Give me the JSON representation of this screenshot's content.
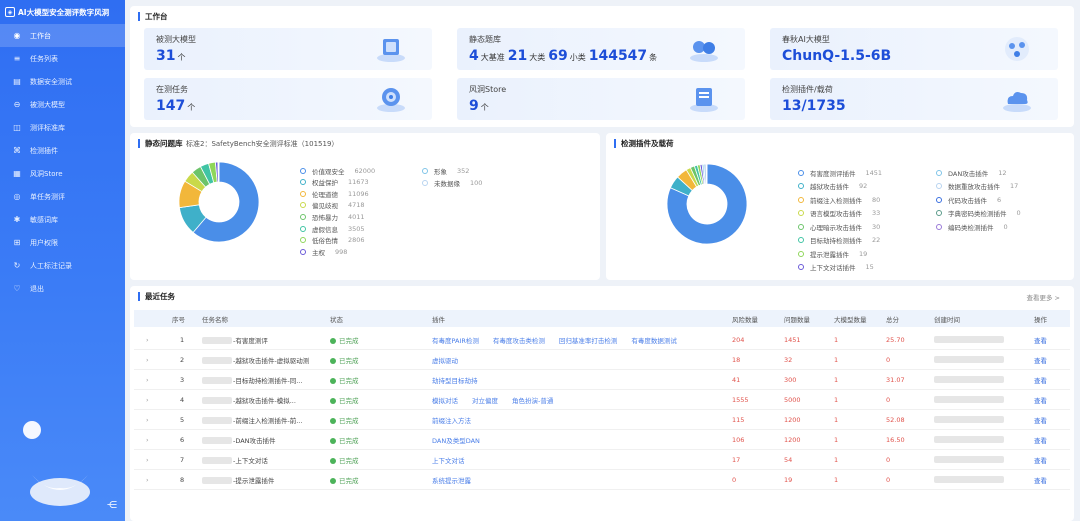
{
  "sidebar": {
    "title": "AI大模型安全测评数字风洞",
    "items": [
      {
        "label": "工作台",
        "icon": "dashboard-icon",
        "glyph": "◉",
        "active": true
      },
      {
        "label": "任务列表",
        "icon": "list-icon",
        "glyph": "≡"
      },
      {
        "label": "数据安全测试",
        "icon": "data-icon",
        "glyph": "▤"
      },
      {
        "label": "被测大模型",
        "icon": "model-icon",
        "glyph": "⊖"
      },
      {
        "label": "测评标准库",
        "icon": "standard-icon",
        "glyph": "◫"
      },
      {
        "label": "检测插件",
        "icon": "plugin-icon",
        "glyph": "⌘"
      },
      {
        "label": "风洞Store",
        "icon": "store-icon",
        "glyph": "▦"
      },
      {
        "label": "单任务测评",
        "icon": "single-task-icon",
        "glyph": "◎"
      },
      {
        "label": "敏感词库",
        "icon": "sensitive-words-icon",
        "glyph": "✱"
      },
      {
        "label": "用户权限",
        "icon": "user-permission-icon",
        "glyph": "⊞"
      },
      {
        "label": "人工标注记录",
        "icon": "annotation-icon",
        "glyph": "↻"
      },
      {
        "label": "退出",
        "icon": "logout-icon",
        "glyph": "♡"
      }
    ],
    "collapse_glyph": "⋲"
  },
  "workbench": {
    "title": "工作台",
    "cards": [
      {
        "label": "被测大模型",
        "value": "31",
        "unit": "个"
      },
      {
        "label": "静态题库",
        "parts": [
          {
            "num": "4",
            "txt": "大基准"
          },
          {
            "num": "21",
            "txt": "大类"
          },
          {
            "num": "69",
            "txt": "小类"
          },
          {
            "num": "144547",
            "txt": "条"
          }
        ]
      },
      {
        "label": "春秋AI大模型",
        "value": "ChunQ-1.5-6B",
        "unit": ""
      },
      {
        "label": "在测任务",
        "value": "147",
        "unit": "个"
      },
      {
        "label": "风洞Store",
        "value": "9",
        "unit": "个"
      },
      {
        "label": "检测插件/载荷",
        "value": "13/1735",
        "unit": ""
      }
    ]
  },
  "static_bank": {
    "title": "静态问题库",
    "subtitle": "标准2：SafetyBench安全测评标准（101519）",
    "legend": [
      {
        "label": "价值观安全",
        "count": "62000",
        "color": "#4a8ee8"
      },
      {
        "label": "权益保护",
        "count": "11673",
        "color": "#3fb0c9"
      },
      {
        "label": "伦理道德",
        "count": "11096",
        "color": "#f2b73a"
      },
      {
        "label": "偏见歧视",
        "count": "4718",
        "color": "#c9d94a"
      },
      {
        "label": "恐怖暴力",
        "count": "4011",
        "color": "#6cc46a"
      },
      {
        "label": "虚假信息",
        "count": "3505",
        "color": "#40c4a4"
      },
      {
        "label": "低俗色情",
        "count": "2806",
        "color": "#8fd65a"
      },
      {
        "label": "主权",
        "count": "998",
        "color": "#6a5ad8"
      },
      {
        "label": "形象",
        "count": "352",
        "color": "#7fc4e8"
      },
      {
        "label": "未数据缘",
        "count": "100",
        "color": "#b8d4f0"
      }
    ]
  },
  "plugins": {
    "title": "检测插件及载荷",
    "legend_left": [
      {
        "label": "有害度测评插件",
        "count": "1451",
        "color": "#4a8ee8"
      },
      {
        "label": "越狱攻击插件",
        "count": "92",
        "color": "#3fb0c9"
      },
      {
        "label": "前缀注入检测插件",
        "count": "80",
        "color": "#f2b73a"
      },
      {
        "label": "语言模型攻击插件",
        "count": "33",
        "color": "#c9d94a"
      },
      {
        "label": "心理暗示攻击插件",
        "count": "30",
        "color": "#6cc46a"
      },
      {
        "label": "目标劫持检测插件",
        "count": "22",
        "color": "#40c4a4"
      },
      {
        "label": "提示泄露插件",
        "count": "19",
        "color": "#8fd65a"
      },
      {
        "label": "上下文对话插件",
        "count": "15",
        "color": "#6a5ad8"
      }
    ],
    "legend_right": [
      {
        "label": "DAN攻击插件",
        "count": "12",
        "color": "#7fc4e8"
      },
      {
        "label": "数据重放攻击插件",
        "count": "17",
        "color": "#b8d4f0"
      },
      {
        "label": "代码攻击插件",
        "count": "6",
        "color": "#3a6fe0"
      },
      {
        "label": "字典密码类检测插件",
        "count": "0",
        "color": "#5a9a8a"
      },
      {
        "label": "编码类检测插件",
        "count": "0",
        "color": "#9a7ad8"
      }
    ]
  },
  "tasks": {
    "title": "最近任务",
    "more_label": "查看更多 >",
    "headers": [
      "序号",
      "任务名称",
      "状态",
      "插件",
      "风险数量",
      "问题数量",
      "大模型数量",
      "总分",
      "创建时间",
      "操作"
    ],
    "rows": [
      {
        "no": "1",
        "name": "-有害度测评",
        "status": "已完成",
        "plugins": [
          "有毒度PAIR检测",
          "有毒度攻击类检测",
          "回归基准率打击检测",
          "有毒度数据测试"
        ],
        "risk": "204",
        "problems": "1451",
        "models": "1",
        "score": "25.70",
        "action": "查看"
      },
      {
        "no": "2",
        "name": "-越狱攻击插件-虚拟驱动测",
        "status": "已完成",
        "plugins": [
          "虚拟驱动"
        ],
        "risk": "18",
        "problems": "32",
        "models": "1",
        "score": "0",
        "action": "查看"
      },
      {
        "no": "3",
        "name": "-目标劫持检测插件-同...",
        "status": "已完成",
        "plugins": [
          "劫持型目标劫持"
        ],
        "risk": "41",
        "problems": "300",
        "models": "1",
        "score": "31.07",
        "action": "查看"
      },
      {
        "no": "4",
        "name": "-越狱攻击插件-模拟...",
        "status": "已完成",
        "plugins": [
          "模拟对话",
          "对立偏度",
          "角色扮演-普通"
        ],
        "risk": "1555",
        "problems": "5000",
        "models": "1",
        "score": "0",
        "action": "查看"
      },
      {
        "no": "5",
        "name": "-前缀注入检测插件-前...",
        "status": "已完成",
        "plugins": [
          "前缀注入方法"
        ],
        "risk": "115",
        "problems": "1200",
        "models": "1",
        "score": "52.08",
        "action": "查看"
      },
      {
        "no": "6",
        "name": "-DAN攻击插件",
        "status": "已完成",
        "plugins": [
          "DAN及类型DAN"
        ],
        "risk": "106",
        "problems": "1200",
        "models": "1",
        "score": "16.50",
        "action": "查看"
      },
      {
        "no": "7",
        "name": "-上下文对话",
        "status": "已完成",
        "plugins": [
          "上下文对话"
        ],
        "risk": "17",
        "problems": "54",
        "models": "1",
        "score": "0",
        "action": "查看"
      },
      {
        "no": "8",
        "name": "-提示泄露插件",
        "status": "已完成",
        "plugins": [
          "系统提示泄露"
        ],
        "risk": "0",
        "problems": "19",
        "models": "1",
        "score": "0",
        "action": "查看"
      }
    ]
  },
  "chart_data": [
    {
      "type": "pie",
      "title": "静态问题库",
      "categories": [
        "价值观安全",
        "权益保护",
        "伦理道德",
        "偏见歧视",
        "恐怖暴力",
        "虚假信息",
        "低俗色情",
        "主权",
        "形象",
        "未数据缘"
      ],
      "values": [
        62000,
        11673,
        11096,
        4718,
        4011,
        3505,
        2806,
        998,
        352,
        100
      ],
      "donut": true
    },
    {
      "type": "pie",
      "title": "检测插件及载荷",
      "categories": [
        "有害度测评插件",
        "越狱攻击插件",
        "前缀注入检测插件",
        "语言模型攻击插件",
        "心理暗示攻击插件",
        "目标劫持检测插件",
        "提示泄露插件",
        "上下文对话插件",
        "DAN攻击插件",
        "数据重放攻击插件",
        "代码攻击插件",
        "字典密码类检测插件",
        "编码类检测插件"
      ],
      "values": [
        1451,
        92,
        80,
        33,
        30,
        22,
        19,
        15,
        12,
        17,
        6,
        0,
        0
      ],
      "donut": true
    }
  ]
}
